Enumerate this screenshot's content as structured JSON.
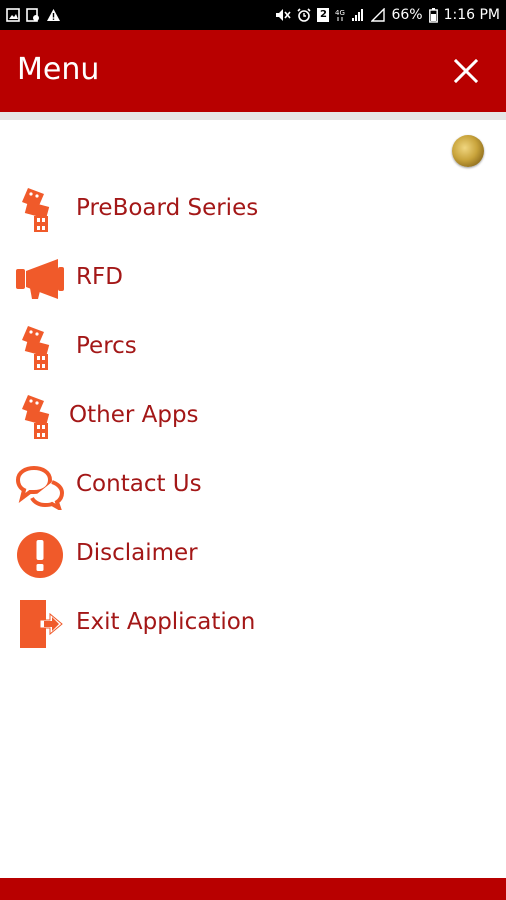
{
  "status_bar": {
    "battery": "66%",
    "time": "1:16 PM",
    "left_icons": [
      "gallery-icon",
      "notification-icon",
      "warning-icon"
    ],
    "right_icons": [
      "mute-icon",
      "alarm-icon",
      "sim-icon",
      "network-4g-icon",
      "signal-icon",
      "battery-icon"
    ],
    "sim_label": "2"
  },
  "header": {
    "title": "Menu",
    "background_color": "#b80000",
    "close_icon": "close-icon"
  },
  "menu": {
    "text_color": "#a31717",
    "icon_color": "#f05a2a",
    "items": [
      {
        "label": "PreBoard Series",
        "icon": "building-blocks-icon"
      },
      {
        "label": "RFD",
        "icon": "megaphone-icon"
      },
      {
        "label": "Percs",
        "icon": "building-blocks-icon"
      },
      {
        "label": "Other Apps",
        "icon": "building-blocks-icon"
      },
      {
        "label": "Contact Us",
        "icon": "chat-bubbles-icon"
      },
      {
        "label": "Disclaimer",
        "icon": "exclamation-icon"
      },
      {
        "label": "Exit Application",
        "icon": "exit-door-icon"
      }
    ]
  }
}
